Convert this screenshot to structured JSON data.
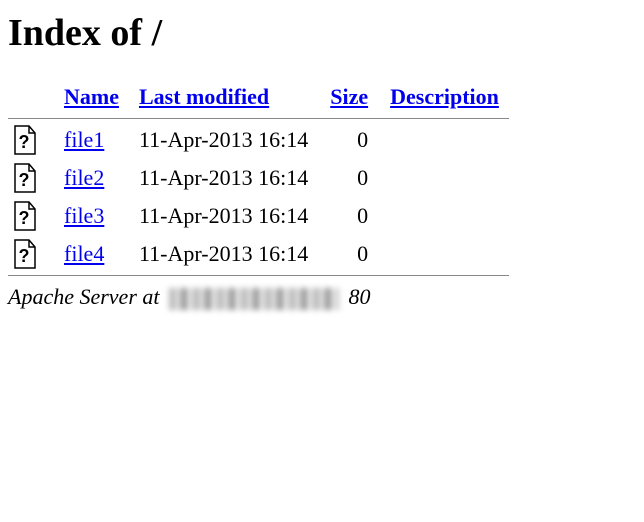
{
  "title": "Index of /",
  "columns": {
    "name": "Name",
    "modified": "Last modified",
    "size": "Size",
    "description": "Description"
  },
  "rows": [
    {
      "name": "file1",
      "modified": "11-Apr-2013 16:14",
      "size": "0",
      "description": ""
    },
    {
      "name": "file2",
      "modified": "11-Apr-2013 16:14",
      "size": "0",
      "description": ""
    },
    {
      "name": "file3",
      "modified": "11-Apr-2013 16:14",
      "size": "0",
      "description": ""
    },
    {
      "name": "file4",
      "modified": "11-Apr-2013 16:14",
      "size": "0",
      "description": ""
    }
  ],
  "footer": {
    "prefix": "Apache Server at ",
    "suffix": " 80"
  }
}
